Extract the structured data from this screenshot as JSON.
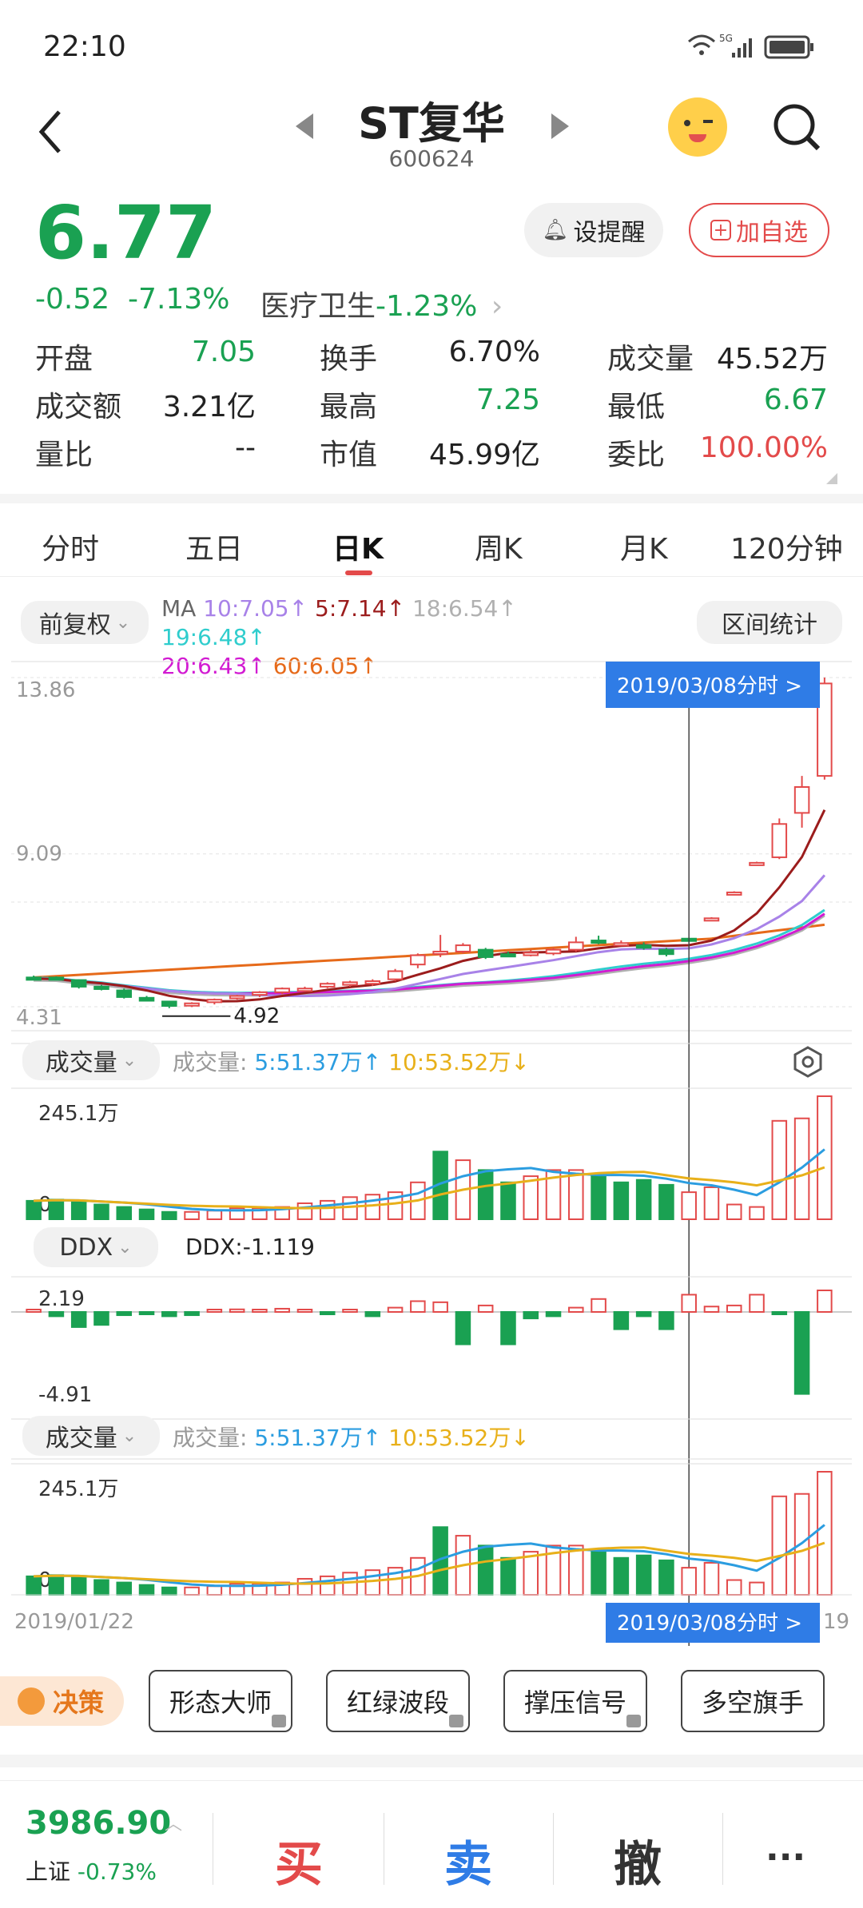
{
  "status": {
    "time": "22:10",
    "network": "5G"
  },
  "header": {
    "title": "ST复华",
    "code": "600624"
  },
  "quote": {
    "price": "6.77",
    "change": "-0.52",
    "change_pct": "-7.13%",
    "sector_name": "医疗卫生",
    "sector_pct": "-1.23%",
    "remind_label": "设提醒",
    "add_label": "加自选",
    "fields": [
      {
        "label": "开盘",
        "value": "7.05"
      },
      {
        "label": "换手",
        "value": "6.70%"
      },
      {
        "label": "成交量",
        "value": "45.52万"
      },
      {
        "label": "成交额",
        "value": "3.21亿"
      },
      {
        "label": "最高",
        "value": "7.25"
      },
      {
        "label": "最低",
        "value": "6.67"
      },
      {
        "label": "量比",
        "value": "--"
      },
      {
        "label": "市值",
        "value": "45.99亿"
      },
      {
        "label": "委比",
        "value": "100.00%"
      }
    ]
  },
  "tabs": [
    "分时",
    "五日",
    "日K",
    "周K",
    "月K",
    "120分钟"
  ],
  "controls": {
    "adjust": "前复权",
    "ma_label": "MA",
    "ma_items": [
      "10:7.05↑",
      "5:7.14↑",
      "18:6.54↑",
      "19:6.48↑",
      "20:6.43↑",
      "60:6.05↑"
    ],
    "range_stats": "区间统计"
  },
  "kline": {
    "max_label": "13.86",
    "mid_label": "9.09",
    "min_label": "4.31",
    "low_mark": "4.92",
    "cursor_date": "2019/03/08",
    "cursor_btn": "分时 >"
  },
  "volume": {
    "selector": "成交量",
    "legend_prefix": "成交量:",
    "ma5": "5:51.37万↑",
    "ma10": "10:53.52万↓",
    "top_label": "245.1万",
    "zero_label": "0"
  },
  "ddx": {
    "selector": "DDX",
    "value_text": "DDX:-1.119",
    "top_label": "2.19",
    "bottom_label": "-4.91"
  },
  "volume2": {
    "selector": "成交量",
    "legend_prefix": "成交量:",
    "ma5": "5:51.37万↑",
    "ma10": "10:53.52万↓",
    "top_label": "245.1万",
    "zero_label": "0"
  },
  "xaxis": {
    "start": "2019/01/22",
    "end_partial": "19"
  },
  "tools": {
    "decision": "决策",
    "items": [
      "形态大师",
      "红绿波段",
      "撑压信号",
      "多空旗手"
    ]
  },
  "bottom": {
    "index_value": "3986.90",
    "index_name": "上证",
    "index_pct": "-0.73%",
    "buy": "买",
    "sell": "卖",
    "cancel": "撤",
    "more": "···"
  },
  "colors": {
    "up": "#e34a4a",
    "down": "#1aa152",
    "accent": "#2f7ce6",
    "ma5": "#9b1c1c",
    "ma10": "#a882e8",
    "ma20": "#d21bd2",
    "ma60": "#e66a1a",
    "ma18": "#b0b0b0",
    "ma19": "#2fcdcd"
  },
  "chart_data": {
    "type": "candlestick",
    "candles": [
      {
        "o": 5.75,
        "c": 5.72,
        "h": 5.8,
        "l": 5.7
      },
      {
        "o": 5.75,
        "c": 5.7,
        "h": 5.78,
        "l": 5.68
      },
      {
        "o": 5.68,
        "c": 5.5,
        "h": 5.7,
        "l": 5.45
      },
      {
        "o": 5.5,
        "c": 5.45,
        "h": 5.55,
        "l": 5.4
      },
      {
        "o": 5.4,
        "c": 5.22,
        "h": 5.45,
        "l": 5.18
      },
      {
        "o": 5.2,
        "c": 5.12,
        "h": 5.25,
        "l": 5.1
      },
      {
        "o": 5.1,
        "c": 4.98,
        "h": 5.12,
        "l": 4.92
      },
      {
        "o": 5.0,
        "c": 5.05,
        "h": 5.08,
        "l": 4.95
      },
      {
        "o": 5.08,
        "c": 5.15,
        "h": 5.18,
        "l": 5.02
      },
      {
        "o": 5.2,
        "c": 5.25,
        "h": 5.28,
        "l": 5.15
      },
      {
        "o": 5.28,
        "c": 5.35,
        "h": 5.38,
        "l": 5.22
      },
      {
        "o": 5.35,
        "c": 5.45,
        "h": 5.48,
        "l": 5.3
      },
      {
        "o": 5.42,
        "c": 5.45,
        "h": 5.5,
        "l": 5.38
      },
      {
        "o": 5.5,
        "c": 5.58,
        "h": 5.62,
        "l": 5.46
      },
      {
        "o": 5.55,
        "c": 5.62,
        "h": 5.66,
        "l": 5.5
      },
      {
        "o": 5.58,
        "c": 5.65,
        "h": 5.7,
        "l": 5.52
      },
      {
        "o": 5.7,
        "c": 5.92,
        "h": 5.98,
        "l": 5.65
      },
      {
        "o": 6.1,
        "c": 6.35,
        "h": 6.4,
        "l": 6.0
      },
      {
        "o": 6.4,
        "c": 6.45,
        "h": 6.9,
        "l": 6.3
      },
      {
        "o": 6.45,
        "c": 6.62,
        "h": 6.68,
        "l": 6.4
      },
      {
        "o": 6.5,
        "c": 6.3,
        "h": 6.55,
        "l": 6.25
      },
      {
        "o": 6.38,
        "c": 6.35,
        "h": 6.45,
        "l": 6.3
      },
      {
        "o": 6.35,
        "c": 6.42,
        "h": 6.5,
        "l": 6.32
      },
      {
        "o": 6.4,
        "c": 6.5,
        "h": 6.55,
        "l": 6.35
      },
      {
        "o": 6.5,
        "c": 6.7,
        "h": 6.85,
        "l": 6.45
      },
      {
        "o": 6.75,
        "c": 6.72,
        "h": 6.88,
        "l": 6.65
      },
      {
        "o": 6.65,
        "c": 6.68,
        "h": 6.75,
        "l": 6.6
      },
      {
        "o": 6.62,
        "c": 6.55,
        "h": 6.7,
        "l": 6.5
      },
      {
        "o": 6.5,
        "c": 6.38,
        "h": 6.55,
        "l": 6.32
      },
      {
        "o": 6.8,
        "c": 6.78,
        "h": 6.82,
        "l": 6.76
      },
      {
        "o": 7.35,
        "c": 7.35,
        "h": 7.38,
        "l": 7.32
      },
      {
        "o": 8.05,
        "c": 8.05,
        "h": 8.08,
        "l": 8.02
      },
      {
        "o": 8.85,
        "c": 8.85,
        "h": 8.88,
        "l": 8.82
      },
      {
        "o": 9.0,
        "c": 9.9,
        "h": 10.05,
        "l": 8.95
      },
      {
        "o": 10.2,
        "c": 10.9,
        "h": 11.2,
        "l": 9.8
      },
      {
        "o": 11.2,
        "c": 13.7,
        "h": 13.86,
        "l": 11.1
      }
    ],
    "volumes": [
      0.15,
      0.16,
      0.15,
      0.12,
      0.1,
      0.08,
      0.06,
      0.06,
      0.07,
      0.09,
      0.09,
      0.1,
      0.13,
      0.15,
      0.18,
      0.2,
      0.22,
      0.3,
      0.55,
      0.48,
      0.4,
      0.3,
      0.35,
      0.4,
      0.4,
      0.35,
      0.3,
      0.32,
      0.28,
      0.22,
      0.26,
      0.12,
      0.1,
      0.8,
      0.82,
      1.0
    ],
    "volume_dirs": [
      -1,
      -1,
      -1,
      -1,
      -1,
      -1,
      -1,
      1,
      1,
      1,
      1,
      1,
      1,
      1,
      1,
      1,
      1,
      1,
      -1,
      1,
      -1,
      -1,
      1,
      1,
      1,
      -1,
      -1,
      -1,
      -1,
      1,
      1,
      1,
      1,
      1,
      1,
      1
    ],
    "ddx": [
      0.05,
      -0.2,
      -0.7,
      -0.6,
      -0.15,
      -0.1,
      -0.2,
      -0.15,
      0.1,
      0.12,
      0.1,
      0.15,
      0.1,
      -0.1,
      0.1,
      -0.2,
      0.2,
      0.5,
      0.45,
      -1.5,
      0.3,
      -1.5,
      -0.3,
      -0.2,
      0.2,
      0.6,
      -0.8,
      -0.2,
      -0.8,
      0.8,
      0.25,
      0.3,
      0.8,
      -0.1,
      -3.8,
      1.0
    ]
  }
}
